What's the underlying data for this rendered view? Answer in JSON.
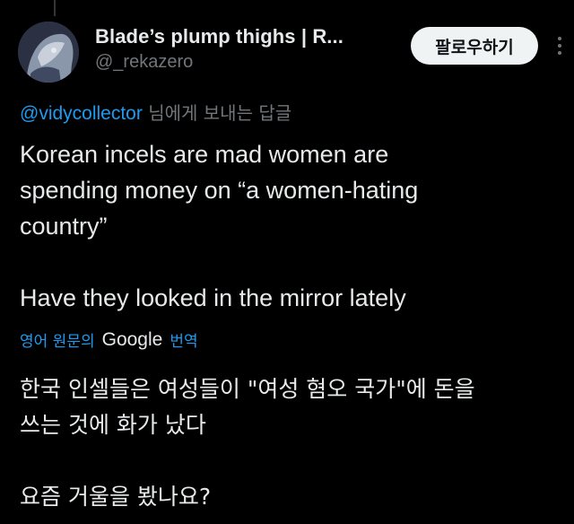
{
  "header": {
    "display_name": "Blade’s plump thighs | R...",
    "handle": "@_rekazero",
    "follow_label": "팔로우하기"
  },
  "reply": {
    "mention": "@vidycollector",
    "suffix": " 님에게 보내는 답글"
  },
  "tweet": {
    "line1": "Korean incels are mad women are",
    "line2": "spending money on “a women-hating",
    "line3": "country”",
    "line4": "Have they looked in the mirror lately"
  },
  "translation_bar": {
    "prefix": "영어 원문의",
    "google": "Google",
    "suffix": "번역"
  },
  "translated": {
    "line1": "한국 인셀들은 여성들이 \"여성 혐오 국가\"에 돈을",
    "line2": "쓰는 것에 화가 났다",
    "line3": "요즘 거울을 봤나요?"
  },
  "colors": {
    "background": "#000000",
    "text": "#e7e9ea",
    "muted": "#71767b",
    "link": "#1d9bf0",
    "button_bg": "#eff3f4"
  },
  "icons": {
    "more": "more-horizontal-icon",
    "avatar": "avatar-image"
  }
}
